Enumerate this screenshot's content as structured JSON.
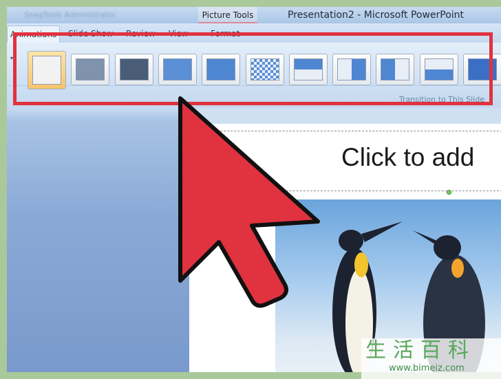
{
  "window": {
    "title": "Presentation2 - Microsoft PowerPoint",
    "context_tab": "Picture Tools",
    "background_item": "SnagTools Administrator"
  },
  "tabs": [
    {
      "label": "Animations",
      "active": true
    },
    {
      "label": "Slide Show"
    },
    {
      "label": "Review"
    },
    {
      "label": "View"
    },
    {
      "label": "Format"
    }
  ],
  "ribbon": {
    "group_label": "Transition to This Slide",
    "transitions": [
      "no-transition",
      "fade-smoothly",
      "fade-through-black",
      "cut",
      "cut-through-black",
      "dissolve",
      "wipe-down",
      "wipe-left",
      "wipe-right",
      "wipe-up",
      "wheel"
    ]
  },
  "slide": {
    "title_placeholder": "Click to add"
  },
  "highlight_color": "#e0323f",
  "watermark": {
    "text": "生活百科",
    "url": "www.bimeiz.com"
  }
}
